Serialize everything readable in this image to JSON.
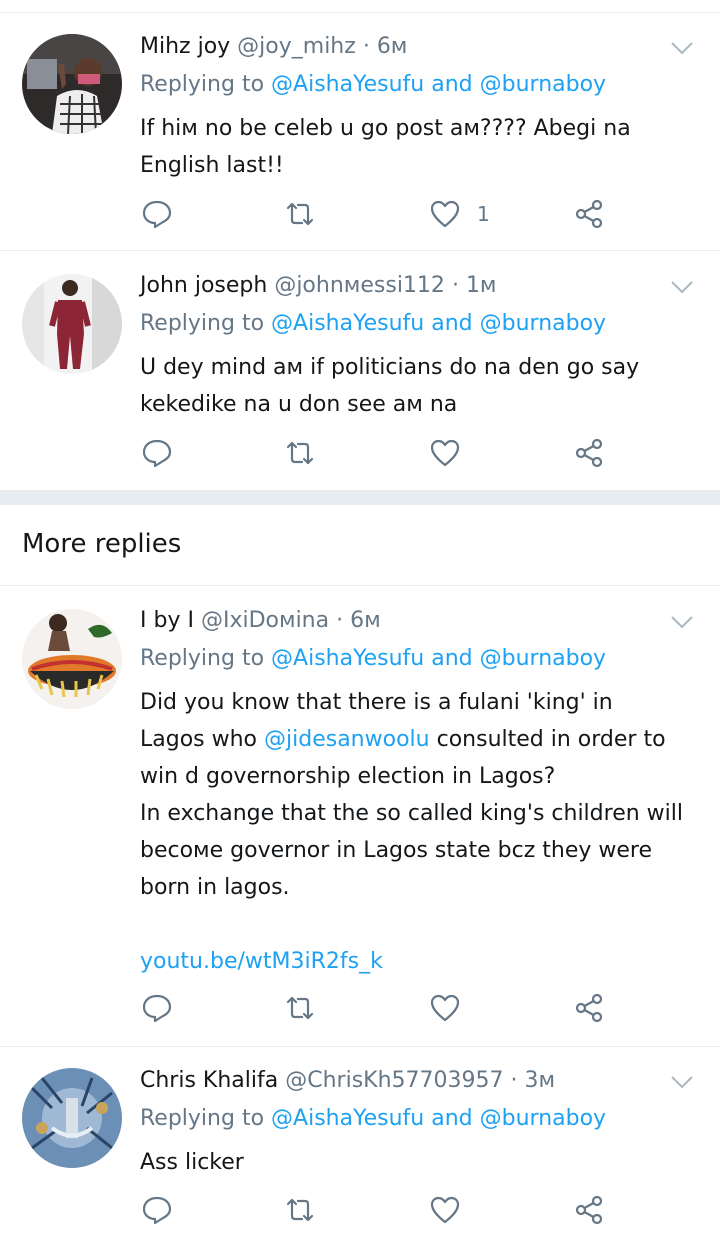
{
  "replies": [
    {
      "name": "Mihz joy",
      "handle": "@joy_mihz",
      "time": "6м",
      "replying_prefix": "Replying to",
      "mention1": "@AishaYesufu",
      "and": "and",
      "mention2": "@burnaboy",
      "text": "If hiм no be celeb u go post aм???? Abegi na English last!!",
      "like_count": "1"
    },
    {
      "name": "John joseph",
      "handle": "@johnмessi112",
      "time": "1м",
      "replying_prefix": "Replying to",
      "mention1": "@AishaYesufu",
      "and": "and",
      "mention2": "@burnaboy",
      "text": "U dey mind aм if politicians do na den go say kekedike na u don see aм na",
      "like_count": ""
    }
  ],
  "more_replies_label": "More replies",
  "more": [
    {
      "name": "I by I",
      "handle": "@IxiDoмina",
      "time": "6м",
      "replying_prefix": "Replying to",
      "mention1": "@AishaYesufu",
      "and": "and",
      "mention2": "@burnaboy",
      "line1": "Did you know that there is a fulani 'king' in",
      "line2_pre": "Lagos who",
      "line2_link": "@jidesanwoolu",
      "line2_post": "consulted in order to",
      "line3": "win d governorship election in Lagos?",
      "line4": "In exchange that the so called king's children will",
      "line5": "becoмe governor in Lagos state bcz they were",
      "line6": "born in lagos.",
      "url": "youtu.be/wtM3iR2fs_k",
      "like_count": ""
    },
    {
      "name": "Chris Khalifa",
      "handle": "@ChrisKh57703957",
      "time": "3м",
      "replying_prefix": "Replying to",
      "mention1": "@AishaYesufu",
      "and": "and",
      "mention2": "@burnaboy",
      "text": "Ass licker",
      "like_count": ""
    }
  ],
  "colors": {
    "link": "#1da1f2",
    "muted": "#657786",
    "divider": "#e6ecf0"
  },
  "icons": [
    "reply-icon",
    "retweet-icon",
    "like-icon",
    "share-icon",
    "chevron-down-icon"
  ]
}
